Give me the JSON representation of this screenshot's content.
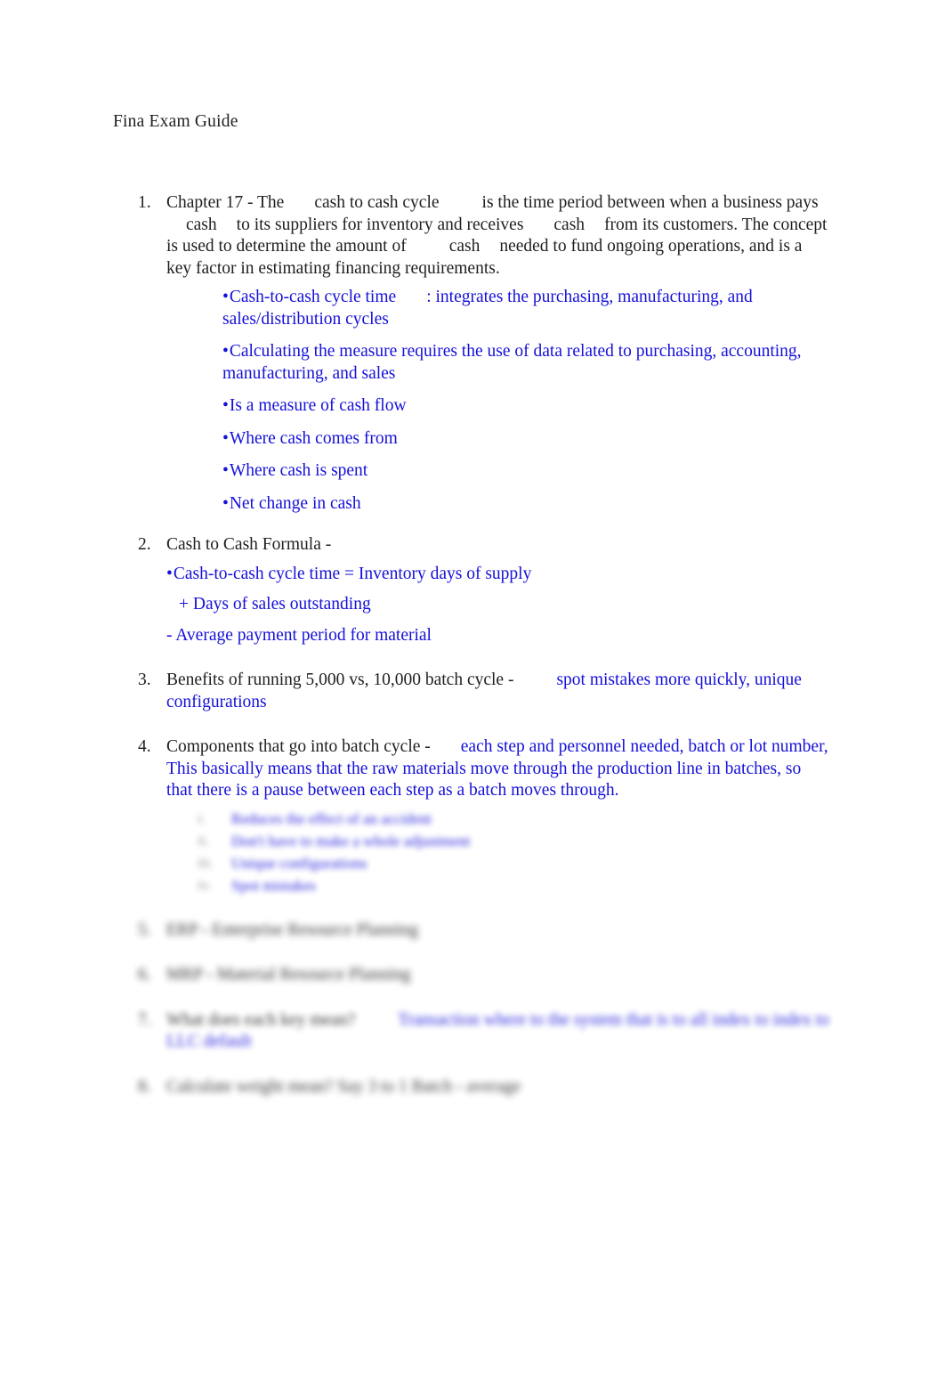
{
  "document": {
    "title": "Fina Exam Guide",
    "background_color": "#ffffff",
    "answer_color": "#1510d8",
    "text_color": "#1f1f1f"
  },
  "items": [
    {
      "number": "1.",
      "lead": "Chapter 17 - The",
      "term": "cash to cash cycle",
      "part2": "is the time period between when a business pays",
      "word1": "cash",
      "part3": "to its suppliers for inventory and receives",
      "word2": "cash",
      "part4": "from its customers. The concept is used to determine the amount of",
      "word3": "cash",
      "part5": "needed to fund ongoing operations, and is a key factor in estimating financing requirements.",
      "bullets": [
        {
          "label": "Cash-to-cash cycle time",
          "rest": ": integrates the purchasing, manufacturing, and sales/distribution cycles"
        },
        {
          "label": "",
          "rest": "Calculating the measure requires the use of data related to purchasing, accounting, manufacturing, and sales"
        },
        {
          "label": "",
          "rest": "Is a measure of cash flow"
        },
        {
          "label": "",
          "rest": "Where cash comes from"
        },
        {
          "label": "",
          "rest": "Where cash is spent"
        },
        {
          "label": "",
          "rest": "Net change in cash"
        }
      ]
    },
    {
      "number": "2.",
      "heading": "Cash to Cash Formula -",
      "formula_lines": [
        "Cash-to-cash cycle time = Inventory days of supply",
        "+ Days of sales outstanding",
        "- Average payment period for material"
      ]
    },
    {
      "number": "3.",
      "question": "Benefits of running 5,000 vs, 10,000 batch cycle -",
      "answer": "spot mistakes more quickly, unique configurations"
    },
    {
      "number": "4.",
      "question": "Components that go into batch cycle -",
      "answer": "each step and personnel needed, batch or lot number, This basically means that the raw materials move through the production line in batches, so that there is a pause between each step as a batch moves through.",
      "sub_items": [
        {
          "marker": "i.",
          "text": "Reduces the effect of an accident"
        },
        {
          "marker": "ii.",
          "text": "Don't have to make a whole adjustment"
        },
        {
          "marker": "iii.",
          "text": "Unique configurations"
        },
        {
          "marker": "iv.",
          "text": "Spot mistakes"
        }
      ]
    },
    {
      "number": "5.",
      "question": "ERP - Enterprise Resource Planning",
      "answer": ""
    },
    {
      "number": "6.",
      "question": "MRP - Material Resource Planning",
      "answer": ""
    },
    {
      "number": "7.",
      "question": "What does each key mean?",
      "answer": "Transaction where to the system that is to all index to index to LLC default"
    },
    {
      "number": "8.",
      "question": "Calculate weight mean? Say 3 to 1 Batch - average",
      "answer": ""
    }
  ]
}
